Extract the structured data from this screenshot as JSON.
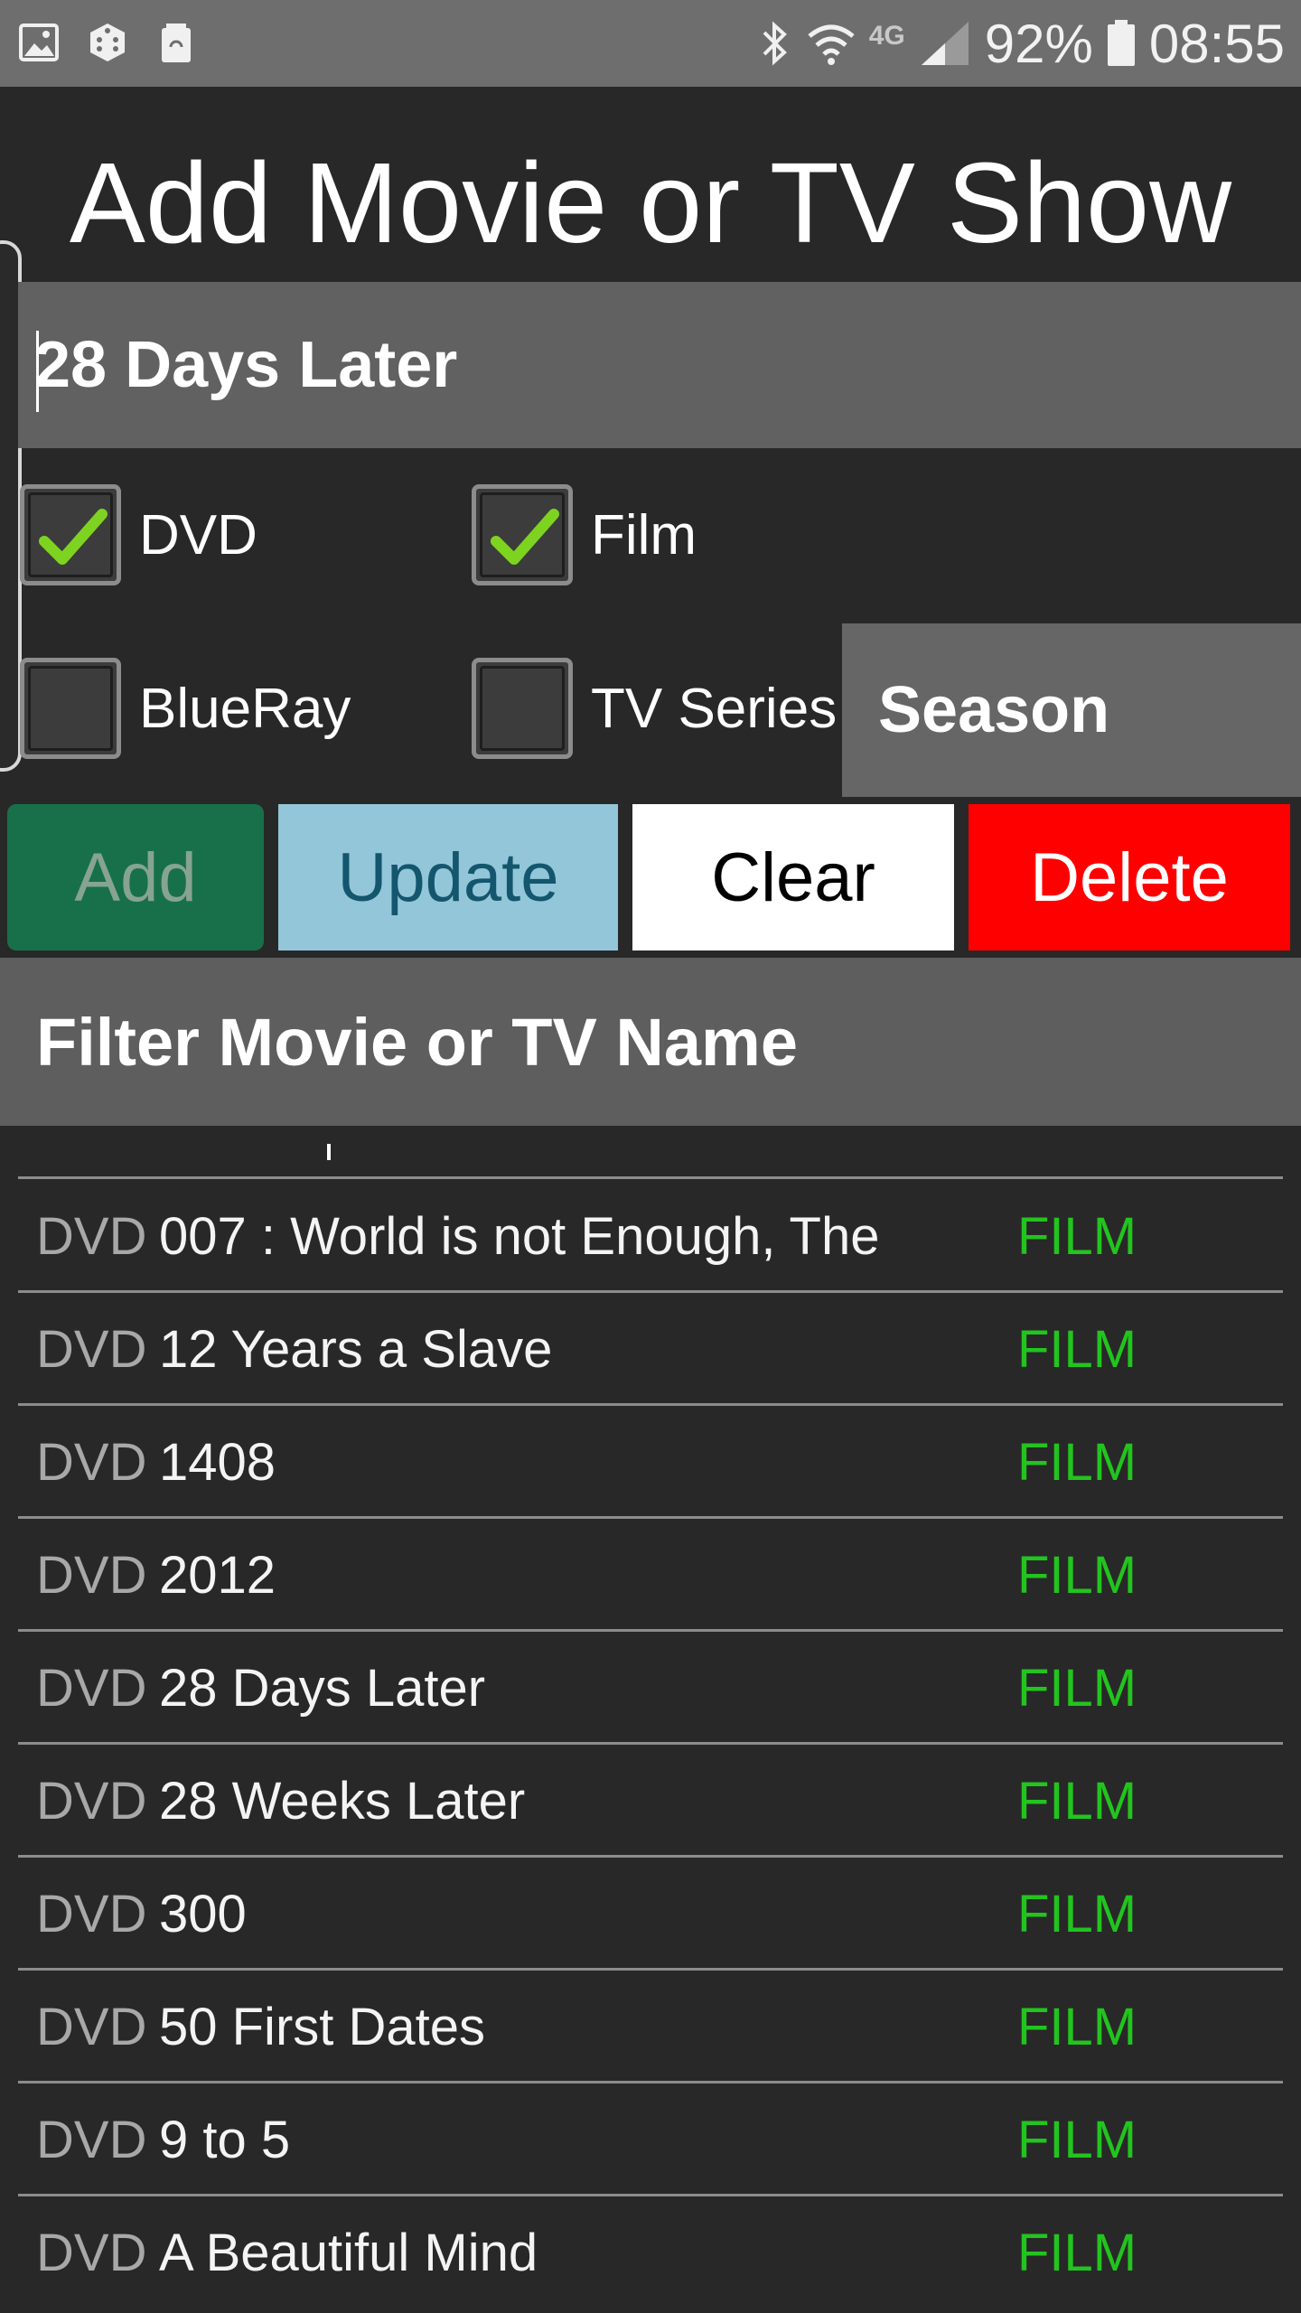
{
  "status_bar": {
    "left_icons": [
      "gallery-icon",
      "dice-icon",
      "battery-saver-icon"
    ],
    "right_icons": [
      "bluetooth-icon",
      "wifi-icon",
      "4g-icon",
      "signal-icon",
      "battery-icon"
    ],
    "network_label": "4G",
    "battery": "92%",
    "time": "08:55"
  },
  "header": {
    "title": "Add Movie or TV Show"
  },
  "form": {
    "name_value": "28 Days Later",
    "checkboxes": [
      {
        "label": "DVD",
        "checked": true
      },
      {
        "label": "Film",
        "checked": true
      },
      {
        "label": "BlueRay",
        "checked": false
      },
      {
        "label": "TV Series",
        "checked": false
      }
    ],
    "season_placeholder": "Season",
    "check_color": "#7ed321"
  },
  "buttons": {
    "add": "Add",
    "update": "Update",
    "clear": "Clear",
    "delete": "Delete"
  },
  "filter": {
    "placeholder": "Filter Movie or TV Name"
  },
  "list": {
    "items": [
      {
        "format": "DVD",
        "title": "007 : World is not Enough, The",
        "type": "FILM"
      },
      {
        "format": "DVD",
        "title": "12 Years a Slave",
        "type": "FILM"
      },
      {
        "format": "DVD",
        "title": "1408",
        "type": "FILM"
      },
      {
        "format": "DVD",
        "title": "2012",
        "type": "FILM"
      },
      {
        "format": "DVD",
        "title": "28 Days Later",
        "type": "FILM"
      },
      {
        "format": "DVD",
        "title": "28 Weeks Later",
        "type": "FILM"
      },
      {
        "format": "DVD",
        "title": "300",
        "type": "FILM"
      },
      {
        "format": "DVD",
        "title": "50 First Dates",
        "type": "FILM"
      },
      {
        "format": "DVD",
        "title": "9 to 5",
        "type": "FILM"
      },
      {
        "format": "DVD",
        "title": "A Beautiful Mind",
        "type": "FILM"
      }
    ]
  },
  "colors": {
    "background": "#282828",
    "status_bar": "#6e6e6e",
    "input_bg": "#616161",
    "add": "#17704a",
    "update": "#93c6d8",
    "clear": "#ffffff",
    "delete": "#ff0000",
    "film_tag": "#22c41e"
  }
}
